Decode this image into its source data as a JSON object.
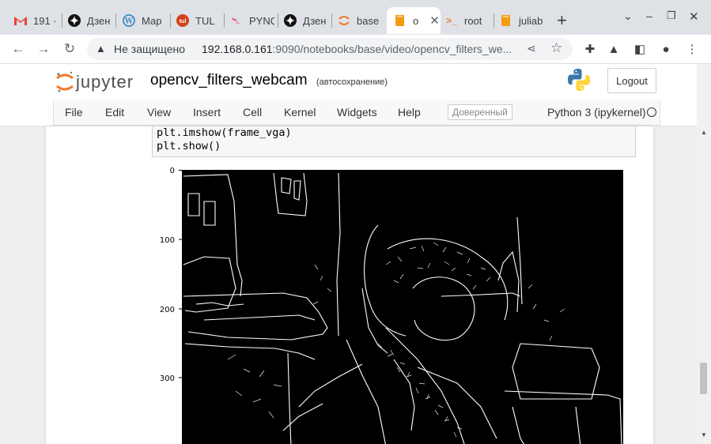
{
  "browser": {
    "tabs": [
      {
        "title": "191 ·",
        "icon": "gmail-icon",
        "active": false
      },
      {
        "title": "Дзен",
        "icon": "dzen-icon",
        "active": false
      },
      {
        "title": "Мар",
        "icon": "wordpress-icon",
        "active": false
      },
      {
        "title": "TUL",
        "icon": "tul-icon",
        "active": false
      },
      {
        "title": "PYNQ",
        "icon": "pynq-icon",
        "active": false
      },
      {
        "title": "Дзен",
        "icon": "dzen-icon",
        "active": false
      },
      {
        "title": "base",
        "icon": "jupyter-icon",
        "active": false
      },
      {
        "title": "o",
        "icon": "notebook-icon",
        "active": true
      },
      {
        "title": "root",
        "icon": "terminal-icon",
        "active": false
      },
      {
        "title": "juliab",
        "icon": "notebook-icon",
        "active": false
      }
    ],
    "new_tab": "+",
    "security_label": "Не защищено",
    "url_host": "192.168.0.161",
    "url_rest": ":9090/notebooks/base/video/opencv_filters_we..."
  },
  "jupyter": {
    "logo_text": "jupyter",
    "notebook_title": "opencv_filters_webcam",
    "autosave": "(автосохранение)",
    "logout_label": "Logout",
    "menu": [
      "File",
      "Edit",
      "View",
      "Insert",
      "Cell",
      "Kernel",
      "Widgets",
      "Help"
    ],
    "trusted": "Доверенный",
    "kernel_name": "Python 3 (ipykernel)"
  },
  "cell": {
    "lines": [
      "plt.imshow(frame_vga)",
      "plt.show()"
    ]
  },
  "plot": {
    "yticks": [
      "0",
      "100",
      "200",
      "300"
    ]
  },
  "colors": {
    "accent_orange": "#f37726",
    "active_tab": "#ffffff",
    "tabbar": "#dee1e6"
  }
}
